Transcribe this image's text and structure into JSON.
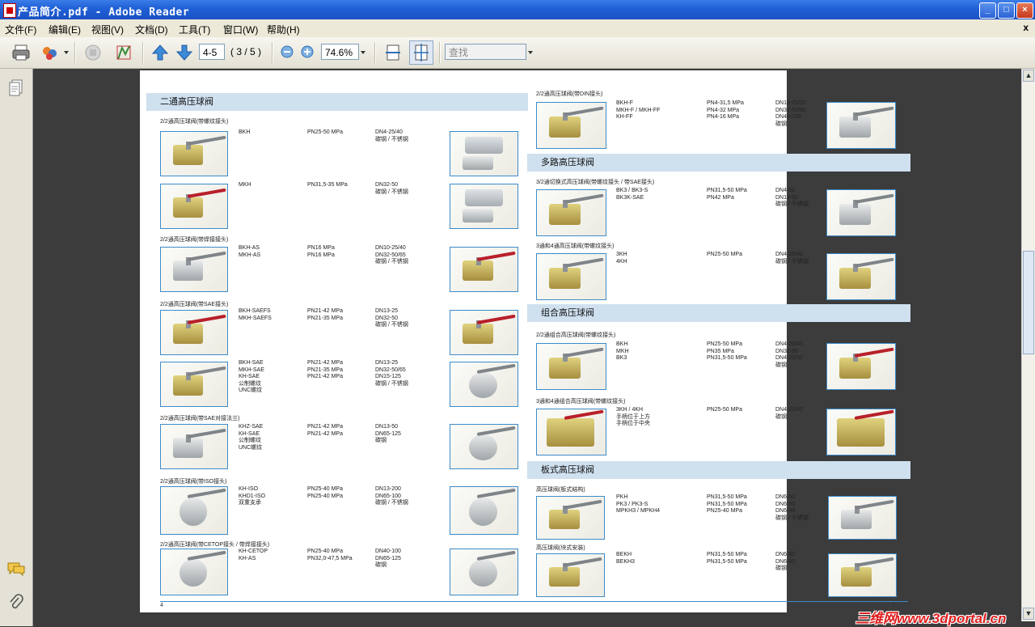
{
  "window": {
    "title": "产品简介.pdf - Adobe Reader"
  },
  "menu": [
    "文件(F)",
    "编辑(E)",
    "视图(V)",
    "文档(D)",
    "工具(T)",
    "窗口(W)",
    "帮助(H)"
  ],
  "menu_close": "x",
  "toolbar": {
    "page_input": "4-5",
    "page_count": "( 3 / 5 )",
    "zoom": "74.6%",
    "find_placeholder": "查找"
  },
  "left_page": {
    "section_title": "二通高压球阀",
    "page_number": "4",
    "groups": [
      {
        "subtitle": "2/2通高压球阀(带螺纹接头)",
        "rows": [
          {
            "models": "BKH",
            "pressure": "PN25-50 MPa",
            "size": "DN4-25/40\n碳钢 / 不锈钢"
          },
          {
            "models": "MKH",
            "pressure": "PN31,5-35 MPa",
            "size": "DN32-50\n碳钢 / 不锈钢"
          }
        ]
      },
      {
        "subtitle": "2/2通高压球阀(带焊接接头)",
        "rows": [
          {
            "models": "BKH-AS\nMKH-AS",
            "pressure": "PN16 MPa\nPN16 MPa",
            "size": "DN10-25/40\nDN32-50/65\n碳钢 / 不锈钢"
          }
        ]
      },
      {
        "subtitle": "2/2通高压球阀(带SAE接头)",
        "rows": [
          {
            "models": "BKH-SAEFS\nMKH-SAEFS",
            "pressure": "PN21-42 MPa\nPN21-35 MPa",
            "size": "DN13-25\nDN32-50\n碳钢 / 不锈钢"
          },
          {
            "models": "BKH-SAE\nMKH-SAE\nKH-SAE\n公制螺纹\nUNC螺纹",
            "pressure": "PN21-42 MPa\nPN21-35 MPa\nPN21-42 MPa",
            "size": "DN13-25\nDN32-50/65\nDN15-125\n碳钢 / 不锈钢"
          }
        ]
      },
      {
        "subtitle": "2/2通高压球阀(带SAE对接法兰)",
        "rows": [
          {
            "models": "KHZ-SAE\nKH-SAE\n公制螺纹\nUNC螺纹",
            "pressure": "PN21-42 MPa\nPN21-42 MPa",
            "size": "DN13-50\nDN65-125\n碳钢"
          }
        ]
      },
      {
        "subtitle": "2/2通高压球阀(带ISO接头)",
        "rows": [
          {
            "models": "KH-ISO\nKHD1-ISO\n双重支承",
            "pressure": "PN25-40 MPa\nPN25-40 MPa",
            "size": "DN13-200\nDN65-100\n碳钢 / 不锈钢"
          }
        ]
      },
      {
        "subtitle": "2/2通高压球阀(带CETOP接头 / 带焊接接头)",
        "rows": [
          {
            "models": "KH-CETOP\nKH-AS",
            "pressure": "PN25-40 MPa\nPN32,0-47,5 MPa",
            "size": "DN40-100\nDN65-125\n碳钢"
          }
        ]
      }
    ]
  },
  "right_page": {
    "page_number": "5",
    "top_group": {
      "subtitle": "2/2通高压球阀(带DIN接头)",
      "rows": [
        {
          "models": "BKH-F\nMKH-F / MKH-FF\nKH-FF",
          "pressure": "PN4-31,5 MPa\nPN4-32 MPa\nPN4-16 MPa",
          "size": "DN15-25/32\nDN32-50/65\nDN40-150\n碳钢"
        }
      ]
    },
    "sections": [
      {
        "title": "多路高压球阀",
        "groups": [
          {
            "subtitle": "3/2通切换式高压球阀(带螺纹接头 / 带SAE接头)",
            "rows": [
              {
                "models": "BK3 / BK3-S\nBK3K-SAE",
                "pressure": "PN31,5-50 MPa\nPN42 MPa",
                "size": "DN4-50\nDN13-50\n碳钢 / 不锈钢"
              }
            ]
          },
          {
            "subtitle": "3通和4通高压球阀(带螺纹接头)",
            "rows": [
              {
                "models": "3KH\n4KH",
                "pressure": "PN25-50 MPa",
                "size": "DN4-25/40\n碳钢 / 不锈钢"
              }
            ]
          }
        ]
      },
      {
        "title": "组合高压球阀",
        "groups": [
          {
            "subtitle": "2/2通组合高压球阀(带螺纹接头)",
            "rows": [
              {
                "models": "BKH\nMKH\nBK3",
                "pressure": "PN25-50 MPa\nPN35 MPa\nPN31,5-50 MPa",
                "size": "DN4-25/40\nDN32-50\nDN4-25/32\n碳钢"
              }
            ]
          },
          {
            "subtitle": "3通和4通组合高压球阀(带螺纹接头)",
            "rows": [
              {
                "models": "3KH / 4KH\n手柄位于上方\n手柄位于中央",
                "pressure": "PN25-50 MPa",
                "size": "DN4-25/40\n碳钢"
              }
            ]
          }
        ]
      },
      {
        "title": "板式高压球阀",
        "groups": [
          {
            "subtitle": "高压球阀(板式结构)",
            "rows": [
              {
                "models": "PKH\nPK3 / PK3-S\nMPKH3 / MPKH4",
                "pressure": "PN31,5-50 MPa\nPN31,5-50 MPa\nPN25-40 MPa",
                "size": "DN6-50\nDN6-50\nDN6-40\n碳钢 / 不锈钢"
              }
            ]
          },
          {
            "subtitle": "高压球阀(块式安装)",
            "rows": [
              {
                "models": "BEKH\nBEKH3",
                "pressure": "PN31,5-50 MPa\nPN31,5-50 MPa",
                "size": "DN6-50\nDN6-50\n碳钢"
              }
            ]
          }
        ]
      }
    ]
  },
  "watermark": "三维网www.3dportal.cn"
}
